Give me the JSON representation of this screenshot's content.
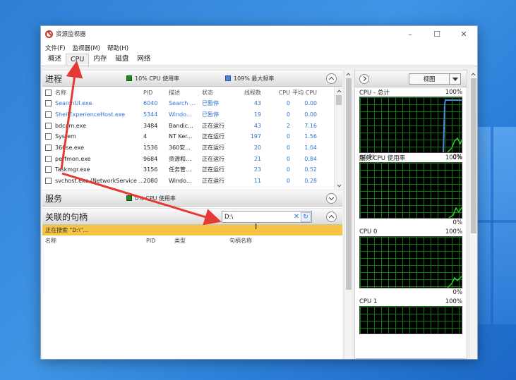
{
  "window": {
    "title": "资源监视器",
    "minimize": "–",
    "maximize": "☐",
    "close": "✕"
  },
  "menu": [
    "文件(F)",
    "监视器(M)",
    "帮助(H)"
  ],
  "tabs": [
    "概述",
    "CPU",
    "内存",
    "磁盘",
    "网络"
  ],
  "processes": {
    "title": "进程",
    "cpu_usage": "10% CPU 使用率",
    "max_freq": "109% 最大频率",
    "columns": [
      "名称",
      "PID",
      "描述",
      "状态",
      "线程数",
      "CPU",
      "平均 CPU"
    ],
    "rows": [
      {
        "name": "SearchUI.exe",
        "pid": "6040",
        "desc": "Search ...",
        "status": "已暂停",
        "threads": "43",
        "cpu": "0",
        "avg": "0.00",
        "suspended": true
      },
      {
        "name": "ShellExperienceHost.exe",
        "pid": "5344",
        "desc": "Windo...",
        "status": "已暂停",
        "threads": "19",
        "cpu": "0",
        "avg": "0.00",
        "suspended": true
      },
      {
        "name": "bdcam.exe",
        "pid": "3484",
        "desc": "Bandic...",
        "status": "正在运行",
        "threads": "43",
        "cpu": "2",
        "avg": "7.16",
        "suspended": false
      },
      {
        "name": "System",
        "pid": "4",
        "desc": "NT Ker...",
        "status": "正在运行",
        "threads": "197",
        "cpu": "0",
        "avg": "1.56",
        "suspended": false
      },
      {
        "name": "360se.exe",
        "pid": "1536",
        "desc": "360安...",
        "status": "正在运行",
        "threads": "20",
        "cpu": "0",
        "avg": "1.04",
        "suspended": false
      },
      {
        "name": "perfmon.exe",
        "pid": "9684",
        "desc": "资源和...",
        "status": "正在运行",
        "threads": "21",
        "cpu": "0",
        "avg": "0.84",
        "suspended": false
      },
      {
        "name": "Taskmgr.exe",
        "pid": "3156",
        "desc": "任务管...",
        "status": "正在运行",
        "threads": "23",
        "cpu": "0",
        "avg": "0.52",
        "suspended": false
      },
      {
        "name": "svchost.exe (NetworkService ...",
        "pid": "2080",
        "desc": "Windo...",
        "status": "正在运行",
        "threads": "11",
        "cpu": "0",
        "avg": "0.28",
        "suspended": false
      }
    ]
  },
  "services": {
    "title": "服务",
    "cpu_usage": "0% CPU 使用率"
  },
  "handles": {
    "title": "关联的句柄",
    "search_value": "D:\\",
    "clear": "✕",
    "refresh": "↻",
    "status": "正在搜索 \"D:\\\"...",
    "columns": [
      "名称",
      "PID",
      "类型",
      "句柄名称"
    ]
  },
  "right_panel": {
    "view_label": "视图",
    "graphs": [
      {
        "title": "CPU - 总计",
        "top": "100%",
        "bottom_left": "60 秒",
        "bottom_right": "0%"
      },
      {
        "title": "服务 CPU 使用率",
        "top": "100%",
        "bottom_left": "",
        "bottom_right": "0%"
      },
      {
        "title": "CPU 0",
        "top": "100%",
        "bottom_left": "",
        "bottom_right": "0%"
      },
      {
        "title": "CPU 1",
        "top": "100%",
        "bottom_left": "",
        "bottom_right": ""
      }
    ]
  },
  "colors": {
    "annotation": "#e53935",
    "suspended": "#2f76d2",
    "graph_line": "#2ad12a",
    "freq_line": "#4b86e0",
    "search_status_bg": "#f6c343"
  }
}
